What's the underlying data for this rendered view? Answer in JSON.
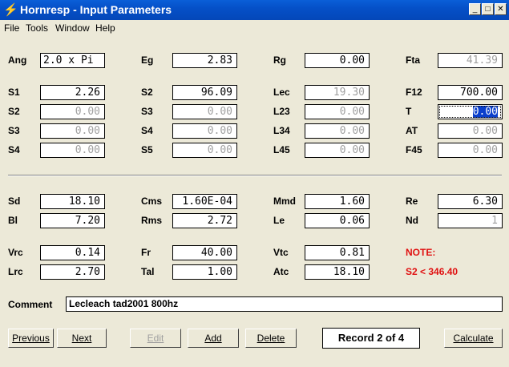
{
  "window": {
    "title": "Hornresp - Input Parameters",
    "min_glyph": "_",
    "max_glyph": "□",
    "close_glyph": "✕",
    "app_icon_glyph": "⚡"
  },
  "menu": [
    "File",
    "Tools",
    "Window",
    "Help"
  ],
  "params": {
    "ang": {
      "label": "Ang",
      "value": "2.0 x Pi"
    },
    "eg": {
      "label": "Eg",
      "value": "2.83"
    },
    "rg": {
      "label": "Rg",
      "value": "0.00"
    },
    "fta": {
      "label": "Fta",
      "value": "41.39"
    },
    "s1": {
      "label": "S1",
      "value": "2.26"
    },
    "s2a": {
      "label": "S2",
      "value": "96.09"
    },
    "lec": {
      "label": "Lec",
      "value": "19.30"
    },
    "f12": {
      "label": "F12",
      "value": "700.00"
    },
    "s2b": {
      "label": "S2",
      "value": "0.00"
    },
    "s3a": {
      "label": "S3",
      "value": "0.00"
    },
    "l23": {
      "label": "L23",
      "value": "0.00"
    },
    "t": {
      "label": "T",
      "value": "0.00"
    },
    "s3b": {
      "label": "S3",
      "value": "0.00"
    },
    "s4a": {
      "label": "S4",
      "value": "0.00"
    },
    "l34": {
      "label": "L34",
      "value": "0.00"
    },
    "at": {
      "label": "AT",
      "value": "0.00"
    },
    "s4b": {
      "label": "S4",
      "value": "0.00"
    },
    "s5": {
      "label": "S5",
      "value": "0.00"
    },
    "l45": {
      "label": "L45",
      "value": "0.00"
    },
    "f45": {
      "label": "F45",
      "value": "0.00"
    },
    "sd": {
      "label": "Sd",
      "value": "18.10"
    },
    "cms": {
      "label": "Cms",
      "value": "1.60E-04"
    },
    "mmd": {
      "label": "Mmd",
      "value": "1.60"
    },
    "re": {
      "label": "Re",
      "value": "6.30"
    },
    "bl": {
      "label": "Bl",
      "value": "7.20"
    },
    "rms": {
      "label": "Rms",
      "value": "2.72"
    },
    "le": {
      "label": "Le",
      "value": "0.06"
    },
    "nd": {
      "label": "Nd",
      "value": "1"
    },
    "vrc": {
      "label": "Vrc",
      "value": "0.14"
    },
    "fr": {
      "label": "Fr",
      "value": "40.00"
    },
    "vtc": {
      "label": "Vtc",
      "value": "0.81"
    },
    "lrc": {
      "label": "Lrc",
      "value": "2.70"
    },
    "tal": {
      "label": "Tal",
      "value": "1.00"
    },
    "atc": {
      "label": "Atc",
      "value": "18.10"
    }
  },
  "note": {
    "title": "NOTE:",
    "text": "S2 < 346.40"
  },
  "comment": {
    "label": "Comment",
    "value": "Lecleach tad2001 800hz"
  },
  "buttons": {
    "previous": {
      "label": "Previous"
    },
    "next": {
      "label": "Next"
    },
    "edit": {
      "label": "Edit"
    },
    "add": {
      "label": "Add"
    },
    "delete": {
      "label": "Delete"
    },
    "calculate": {
      "label": "Calculate"
    }
  },
  "record": "Record 2 of 4",
  "colors": {
    "title_bar": "#0550c8",
    "window_bg": "#ece9d8",
    "note_red": "#e01010",
    "selection": "#0a3fcc"
  }
}
